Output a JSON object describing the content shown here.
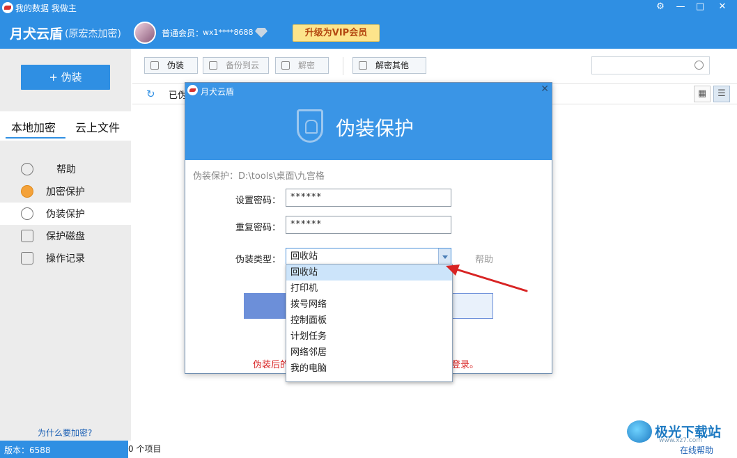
{
  "window": {
    "title": "我的数据 我做主",
    "brand": "月犬云盾",
    "brand_sub": "(原宏杰加密)",
    "member_label": "普通会员：",
    "member_id": "wx1****8688",
    "vip_button": "升级为VIP会员",
    "controls": [
      "⚙",
      "—",
      "□",
      "✕"
    ]
  },
  "sidebar": {
    "disguise_button": "+ 伪装",
    "tabs": [
      "本地加密",
      "云上文件"
    ],
    "active_tab": "本地加密",
    "items": [
      {
        "label": "帮助",
        "icon": "help-icon"
      },
      {
        "label": "加密保护",
        "icon": "lock-icon"
      },
      {
        "label": "伪装保护",
        "icon": "shield-icon"
      },
      {
        "label": "保护磁盘",
        "icon": "disk-icon"
      },
      {
        "label": "操作记录",
        "icon": "clipboard-icon"
      }
    ],
    "active_item": "伪装保护",
    "why_link": "为什么要加密?"
  },
  "toolbar": {
    "buttons": [
      {
        "label": "伪装",
        "enabled": true
      },
      {
        "label": "备份到云",
        "enabled": false
      },
      {
        "label": "解密",
        "enabled": false
      },
      {
        "label": "解密其他",
        "enabled": true
      }
    ],
    "search_placeholder": ""
  },
  "subbar": {
    "status_text": "已伪"
  },
  "statusbar": {
    "version": "版本：6588",
    "item_count": "0 个项目",
    "help": "在线帮助"
  },
  "watermark": {
    "text": "极光下载站",
    "url": "www.xz7.com"
  },
  "dialog": {
    "title": "月犬云盾",
    "heading": "伪装保护",
    "path_label": "伪装保护：D:\\tools\\桌面\\九宫格",
    "password_label": "设置密码：",
    "password_value": "******",
    "repeat_label": "重复密码：",
    "repeat_value": "******",
    "type_label": "伪装类型：",
    "type_value": "回收站",
    "help": "帮助",
    "warning_left": "伪装后的",
    "warning_right": "登录。"
  },
  "dropdown": {
    "options": [
      "回收站",
      "打印机",
      "拨号网络",
      "控制面板",
      "计划任务",
      "网络邻居",
      "我的电脑"
    ],
    "selected": "回收站"
  },
  "colors": {
    "accent": "#2f8fe3",
    "warning": "#d82424",
    "arrow": "#d82424"
  }
}
